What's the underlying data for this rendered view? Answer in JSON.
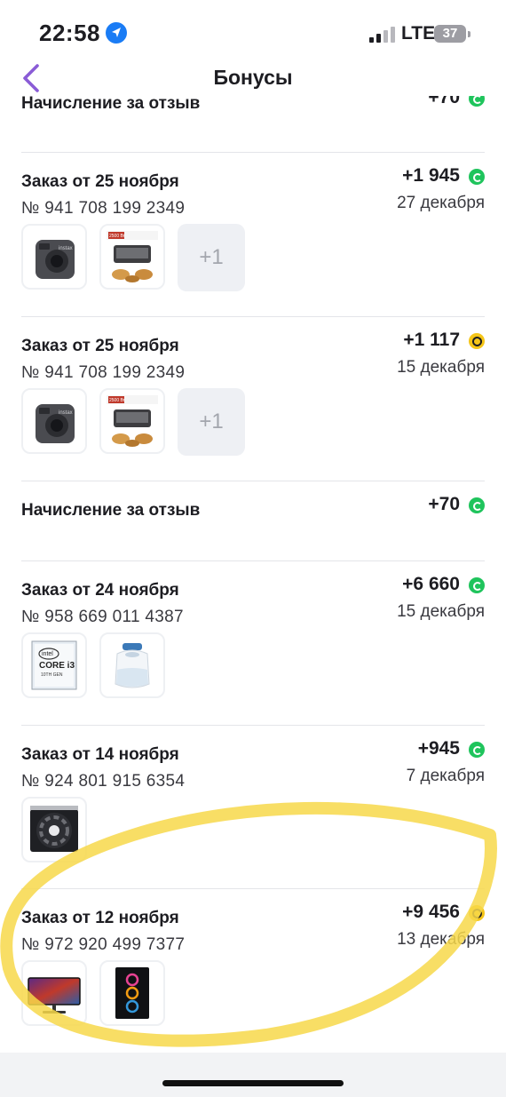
{
  "status_bar": {
    "time": "22:58",
    "network": "LTE",
    "battery": "37"
  },
  "nav": {
    "title": "Бонусы"
  },
  "transactions": [
    {
      "title": "Начисление за отзыв",
      "amount": "+70",
      "coin": "green"
    },
    {
      "title": "Заказ от 25 ноября",
      "number": "№ 941 708 199 2349",
      "amount": "+1 945",
      "coin": "green",
      "date": "27 декабря",
      "more": "+1",
      "thumbs": [
        "instax-camera",
        "grill"
      ]
    },
    {
      "title": "Заказ от 25 ноября",
      "number": "№ 941 708 199 2349",
      "amount": "+1 117",
      "coin": "yellow",
      "date": "15 декабря",
      "more": "+1",
      "thumbs": [
        "instax-camera",
        "grill"
      ]
    },
    {
      "title": "Начисление за отзыв",
      "amount": "+70",
      "coin": "green"
    },
    {
      "title": "Заказ от 24 ноября",
      "number": "№ 958 669 011 4387",
      "amount": "+6 660",
      "coin": "green",
      "date": "15 декабря",
      "thumbs": [
        "intel-core-i3",
        "humidifier"
      ]
    },
    {
      "title": "Заказ от 14 ноября",
      "number": "№ 924 801 915 6354",
      "amount": "+945",
      "coin": "green",
      "date": "7 декабря",
      "thumbs": [
        "cpu-cooler"
      ]
    },
    {
      "title": "Заказ от 12 ноября",
      "number": "№ 972 920 499 7377",
      "amount": "+9 456",
      "coin": "yellow",
      "date": "13 декабря",
      "thumbs": [
        "monitor",
        "pc-case"
      ]
    }
  ],
  "thumb_labels": {
    "camera_brand": "instax",
    "grill_badge": "2500 Вт",
    "cpu_brand": "intel",
    "cpu_model": "CORE i3",
    "cpu_gen": "10TH GEN"
  },
  "colors": {
    "accent": "#8a5cd6",
    "bonus_green": "#1fc45c",
    "bonus_yellow": "#f5c518",
    "highlight": "#f7d84a"
  }
}
